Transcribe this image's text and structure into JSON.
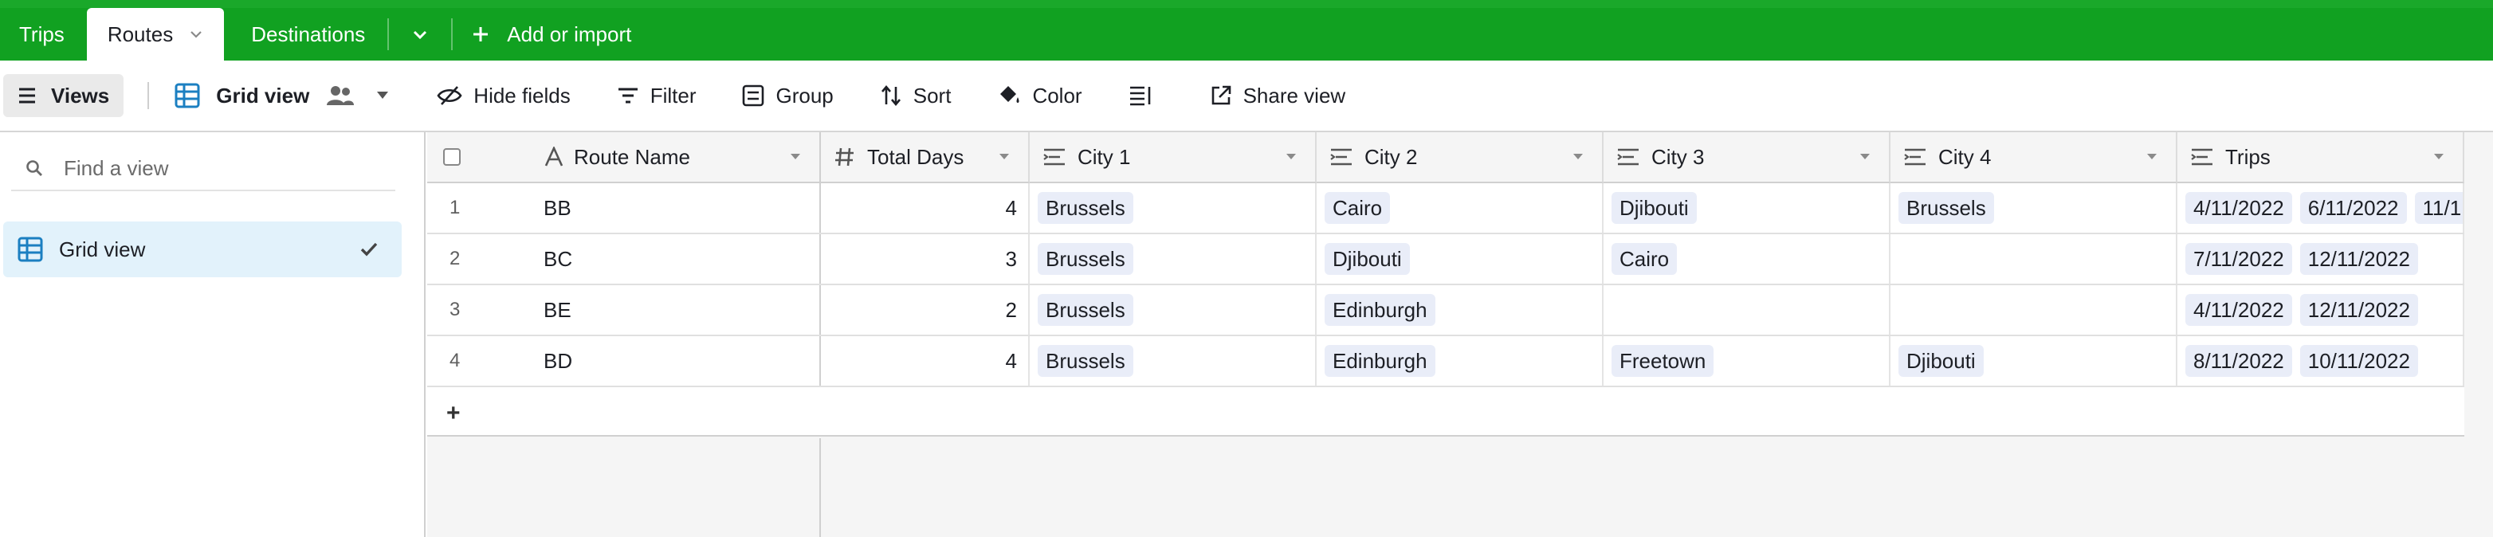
{
  "tabs": [
    {
      "label": "Trips",
      "active": false
    },
    {
      "label": "Routes",
      "active": true
    },
    {
      "label": "Destinations",
      "active": false
    }
  ],
  "add_import_label": "Add or import",
  "toolbar": {
    "views_label": "Views",
    "grid_view_label": "Grid view",
    "hide_fields_label": "Hide fields",
    "filter_label": "Filter",
    "group_label": "Group",
    "sort_label": "Sort",
    "color_label": "Color",
    "share_view_label": "Share view"
  },
  "sidebar": {
    "find_placeholder": "Find a view",
    "views": [
      {
        "label": "Grid view",
        "selected": true
      }
    ]
  },
  "table": {
    "columns": [
      {
        "label": "Route Name",
        "icon": "text-icon"
      },
      {
        "label": "Total Days",
        "icon": "hash-icon"
      },
      {
        "label": "City 1",
        "icon": "lookup-icon"
      },
      {
        "label": "City 2",
        "icon": "lookup-icon"
      },
      {
        "label": "City 3",
        "icon": "lookup-icon"
      },
      {
        "label": "City 4",
        "icon": "lookup-icon"
      },
      {
        "label": "Trips",
        "icon": "lookup-icon"
      }
    ],
    "rows": [
      {
        "num": "1",
        "route": "BB",
        "days": "4",
        "city1": "Brussels",
        "city2": "Cairo",
        "city3": "Djibouti",
        "city4": "Brussels",
        "trips": [
          "4/11/2022",
          "6/11/2022",
          "11/1"
        ]
      },
      {
        "num": "2",
        "route": "BC",
        "days": "3",
        "city1": "Brussels",
        "city2": "Djibouti",
        "city3": "Cairo",
        "city4": "",
        "trips": [
          "7/11/2022",
          "12/11/2022"
        ]
      },
      {
        "num": "3",
        "route": "BE",
        "days": "2",
        "city1": "Brussels",
        "city2": "Edinburgh",
        "city3": "",
        "city4": "",
        "trips": [
          "4/11/2022",
          "12/11/2022"
        ]
      },
      {
        "num": "4",
        "route": "BD",
        "days": "4",
        "city1": "Brussels",
        "city2": "Edinburgh",
        "city3": "Freetown",
        "city4": "Djibouti",
        "trips": [
          "8/11/2022",
          "10/11/2022"
        ]
      }
    ],
    "add_row_symbol": "+"
  },
  "colors": {
    "tabbar": "#11a121",
    "grid_icon": "#1b7fc1",
    "chip_bg": "#e9edf8",
    "selected_view_bg": "#e2f2fb"
  }
}
